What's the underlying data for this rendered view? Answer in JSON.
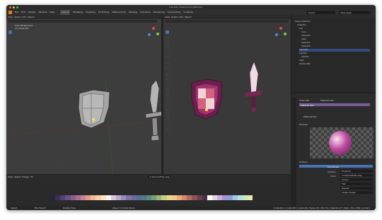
{
  "window": {
    "title": "Low Poly Shield.blend (Blender)"
  },
  "menu": [
    "File",
    "Edit",
    "Render",
    "Window",
    "Help"
  ],
  "workspace_tabs": [
    "Layout",
    "Modeling",
    "Sculpting",
    "UV Editing",
    "Texture Paint",
    "Shading",
    "Animation",
    "Rendering",
    "Compositing",
    "Scripting"
  ],
  "scene": {
    "name": "Scene",
    "view_layer": "View Layer"
  },
  "uv_editor": {
    "header": [
      "View",
      "Select",
      "Image",
      "UV"
    ],
    "image_name": "ui-textureFlats.png",
    "overlay_title": "User Perspective",
    "overlay_object": "(1) Cube.001"
  },
  "viewport": {
    "header": [
      "View",
      "Select",
      "Add",
      "Object",
      "Node",
      "Edge",
      "Face",
      "UV"
    ],
    "shading": "Slot 1"
  },
  "outliner": {
    "rows": [
      {
        "label": "Scene Collection",
        "selected": false
      },
      {
        "label": "Collection",
        "selected": false
      },
      {
        "label": "Axe",
        "selected": false
      },
      {
        "label": "Cube",
        "selected": false
      },
      {
        "label": "Cube.003",
        "selected": false
      },
      {
        "label": "Cube",
        "selected": false
      },
      {
        "label": "Cube.002",
        "selected": false
      },
      {
        "label": "Cube.005",
        "selected": false
      },
      {
        "label": "Cube.001",
        "selected": true
      },
      {
        "label": "Cylinder",
        "selected": false
      },
      {
        "label": "Cylinder",
        "selected": false
      },
      {
        "label": "Light",
        "selected": false
      },
      {
        "label": "Camera.001",
        "selected": false
      }
    ]
  },
  "properties": {
    "object": "Cube.001",
    "material_tab": "Material.001",
    "material_slot": "Material.001",
    "material_name": "Material.001",
    "tabs": [
      "Preview",
      "Surface"
    ],
    "surface_shader": "Use Nodes",
    "fields": [
      {
        "label": "Surface",
        "value": "Emission"
      },
      {
        "label": "Color",
        "value": "ui-textureFlats.png"
      },
      {
        "label": "",
        "value": "Linear"
      },
      {
        "label": "",
        "value": "Flat"
      },
      {
        "label": "",
        "value": "Repeat"
      },
      {
        "label": "",
        "value": "Single Image"
      }
    ],
    "uv_header": "UVMap",
    "uv_label": "Slot"
  },
  "statusbar": {
    "left": "Collection | Cube.001 | Verts:40 | Faces:26 | Tris:72 | Objects:1/7 | Mem: 55.2 MiB | v2.92.0",
    "hints": [
      "Select",
      "Box Select",
      "Rotate View",
      "Object Context Menu"
    ]
  },
  "palette_colors": [
    "#2b2240",
    "#3a2f55",
    "#50406f",
    "#6b4f87",
    "#8a5f8f",
    "#a86f90",
    "#c9838e",
    "#e19a8c",
    "#f2b897",
    "#f7d1a8",
    "#fbe4c4",
    "#fff5e6",
    "#d9c6d9",
    "#b8a7c9",
    "#9a8ab8",
    "#7d74a6",
    "#6a6d9a",
    "#5a6d8c",
    "#4f7a86",
    "#5b8b7e",
    "#76a07a",
    "#9cb87a",
    "#c9cf82",
    "#e8d98c",
    "#f1c98a",
    "#e9a97a",
    "#d38a6e",
    "#b26b61",
    "#8d5258",
    "#6b3f4f",
    "#4d2f45",
    "#ffffff",
    "#e7d3e2",
    "#c7aee0",
    "#a892d0",
    "#8aa0d8",
    "#9ec8e6",
    "#b8e0e0",
    "#c9e8c2",
    "#eae6a6"
  ]
}
